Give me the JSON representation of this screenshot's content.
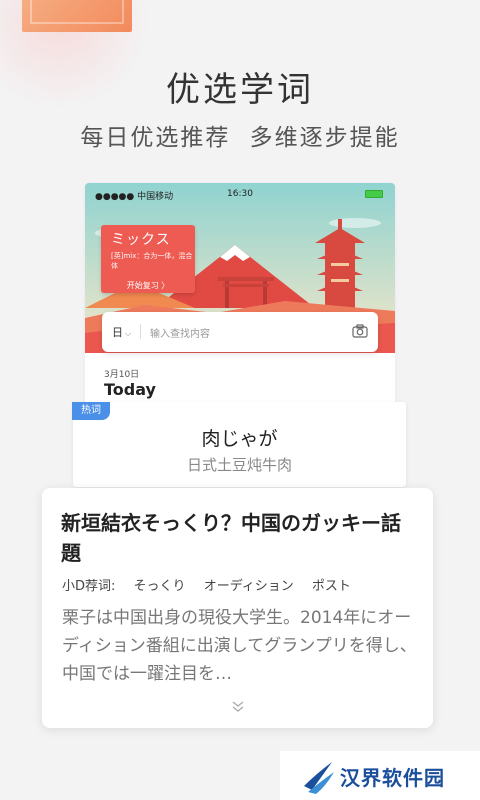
{
  "hero": {
    "title": "优选学词",
    "subtitle": "每日优选推荐 多维逐步提能"
  },
  "phone": {
    "status": {
      "signal": "●●●●● 中国移动",
      "time": "16:30"
    },
    "word_card": {
      "word": "ミックス",
      "meaning": "[英]mix：合为一体，混合体",
      "review_button": "开始复习 〉"
    },
    "search": {
      "language": "日",
      "placeholder": "输入查找内容"
    },
    "date": "3月10日",
    "today": "Today"
  },
  "hot_word": {
    "badge": "热词",
    "word": "肉じゃが",
    "meaning": "日式土豆炖牛肉"
  },
  "news": {
    "title": "新垣結衣そっくり？中国のガッキー話題",
    "tags_label": "小D荐词:",
    "tags": [
      "そっくり",
      "オーディション",
      "ポスト"
    ],
    "body": "栗子は中国出身の現役大学生。2014年にオーディション番組に出演してグランプリを得し、中国では一躍注目を…"
  },
  "footer": {
    "brand": "汉界软件园"
  },
  "colors": {
    "accent_red": "#ee5b52",
    "badge_blue": "#4a8fe8",
    "brand_blue": "#1b4f9c"
  }
}
